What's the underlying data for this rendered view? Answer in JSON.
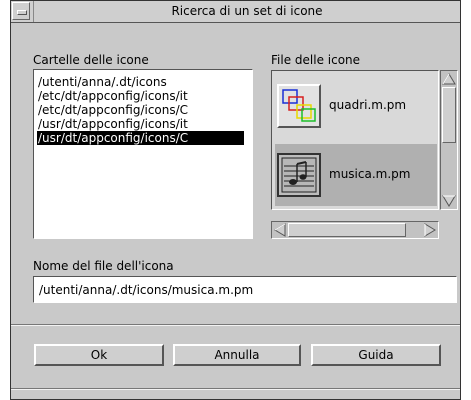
{
  "window": {
    "title": "Ricerca di un set di icone",
    "menu_icon": "window-menu-icon"
  },
  "folders": {
    "label": "Cartelle delle icone",
    "items": [
      "/utenti/anna/.dt/icons",
      "/etc/dt/appconfig/icons/it",
      "/etc/dt/appconfig/icons/C",
      "/usr/dt/appconfig/icons/it",
      "/usr/dt/appconfig/icons/C"
    ],
    "selected_index": 4
  },
  "files": {
    "label": "File delle icone",
    "items": [
      {
        "name": "quadri.m.pm",
        "icon": "colored-squares-icon"
      },
      {
        "name": "musica.m.pm",
        "icon": "music-sheet-icon"
      }
    ],
    "selected_index": 1
  },
  "filename": {
    "label": "Nome del file dell'icona",
    "value": "/utenti/anna/.dt/icons/musica.m.pm"
  },
  "buttons": {
    "ok": "Ok",
    "cancel": "Annulla",
    "help": "Guida"
  }
}
